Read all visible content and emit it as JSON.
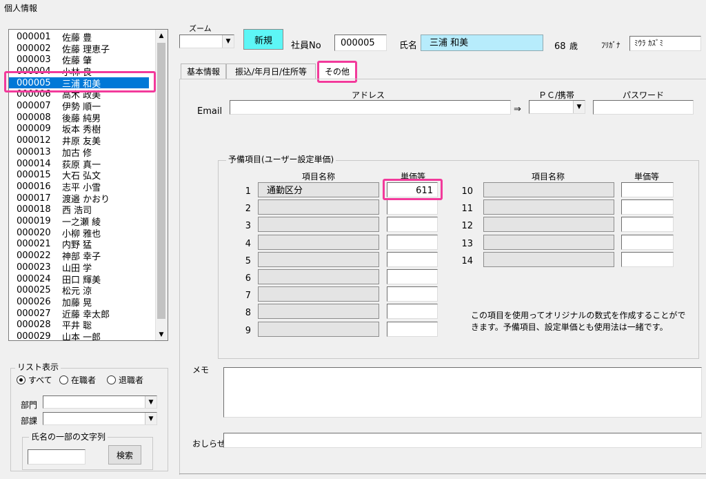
{
  "window": {
    "title": "個人情報"
  },
  "employee_list": {
    "items": [
      {
        "code": "000001",
        "name": "佐藤 豊"
      },
      {
        "code": "000002",
        "name": "佐藤 理恵子"
      },
      {
        "code": "000003",
        "name": "佐藤 肇"
      },
      {
        "code": "000004",
        "name": "小林 良一"
      },
      {
        "code": "000005",
        "name": "三浦  和美"
      },
      {
        "code": "000006",
        "name": "高木 政美"
      },
      {
        "code": "000007",
        "name": "伊勢  順一"
      },
      {
        "code": "000008",
        "name": "後藤 純男"
      },
      {
        "code": "000009",
        "name": "坂本 秀樹"
      },
      {
        "code": "000012",
        "name": "井原 友美"
      },
      {
        "code": "000013",
        "name": "加古 修"
      },
      {
        "code": "000014",
        "name": "荻原 真一"
      },
      {
        "code": "000015",
        "name": "大石 弘文"
      },
      {
        "code": "000016",
        "name": "志平 小雪"
      },
      {
        "code": "000017",
        "name": "渡邉 かおり"
      },
      {
        "code": "000018",
        "name": "西 浩司"
      },
      {
        "code": "000019",
        "name": "一之瀬 綾"
      },
      {
        "code": "000020",
        "name": "小柳 雅也"
      },
      {
        "code": "000021",
        "name": "内野 猛"
      },
      {
        "code": "000022",
        "name": "神部 幸子"
      },
      {
        "code": "000023",
        "name": "山田 学"
      },
      {
        "code": "000024",
        "name": "田口 輝美"
      },
      {
        "code": "000025",
        "name": "松元 涼"
      },
      {
        "code": "000026",
        "name": "加藤 晃"
      },
      {
        "code": "000027",
        "name": "近藤 幸太郎"
      },
      {
        "code": "000028",
        "name": "平井 聡"
      },
      {
        "code": "000029",
        "name": "山本 一郎"
      }
    ],
    "selected_code": "000005",
    "scroll_up": "▲",
    "scroll_down": "▼"
  },
  "list_display": {
    "title": "リスト表示",
    "radio_all": "すべて",
    "radio_active": "在職者",
    "radio_retired": "退職者",
    "dept_label": "部門",
    "section_label": "部課",
    "name_search_title": "氏名の一部の文字列",
    "search_button": "検索",
    "search_value": ""
  },
  "header": {
    "zoom_label": "ズーム",
    "zoom_value": "",
    "new_button": "新規",
    "emp_no_label": "社員No",
    "emp_no_value": "000005",
    "name_label": "氏名",
    "name_value": "三浦  和美",
    "age_value": "68",
    "age_unit": "歳",
    "furigana_label": "ﾌﾘｶﾞﾅ",
    "furigana_value": "ﾐｳﾗ ｶｽﾞﾐ"
  },
  "tabs": [
    {
      "label": "基本情報"
    },
    {
      "label": "振込/年月日/住所等"
    },
    {
      "label": "その他"
    }
  ],
  "email": {
    "label": "Email",
    "address_header": "アドレス",
    "address_value": "",
    "arrow": "⇒",
    "device_header": "ＰＣ/携帯",
    "device_value": "",
    "password_header": "パスワード",
    "password_value": ""
  },
  "reserve": {
    "group_title": "予備項目(ユーザー設定単価)",
    "item_name_header": "項目名称",
    "unit_price_header": "単価等",
    "left_items": [
      {
        "no": "1",
        "name": "通勤区分",
        "price": "611"
      },
      {
        "no": "2",
        "name": "",
        "price": ""
      },
      {
        "no": "3",
        "name": "",
        "price": ""
      },
      {
        "no": "4",
        "name": "",
        "price": ""
      },
      {
        "no": "5",
        "name": "",
        "price": ""
      },
      {
        "no": "6",
        "name": "",
        "price": ""
      },
      {
        "no": "7",
        "name": "",
        "price": ""
      },
      {
        "no": "8",
        "name": "",
        "price": ""
      },
      {
        "no": "9",
        "name": "",
        "price": ""
      }
    ],
    "right_items": [
      {
        "no": "10",
        "name": "",
        "price": ""
      },
      {
        "no": "11",
        "name": "",
        "price": ""
      },
      {
        "no": "12",
        "name": "",
        "price": ""
      },
      {
        "no": "13",
        "name": "",
        "price": ""
      },
      {
        "no": "14",
        "name": "",
        "price": ""
      }
    ],
    "note_line1": "この項目を使用ってオリジナルの数式を作成することがで",
    "note_line2": "きます。予備項目、設定単価とも使用法は一緒です。"
  },
  "memo": {
    "label": "メモ",
    "value": ""
  },
  "notice": {
    "label": "おしらせ",
    "value": ""
  },
  "colors": {
    "highlight": "#f23a9b",
    "selection": "#0078d7",
    "name_field": "#b7ecfc",
    "new_button": "#5df6f6"
  }
}
